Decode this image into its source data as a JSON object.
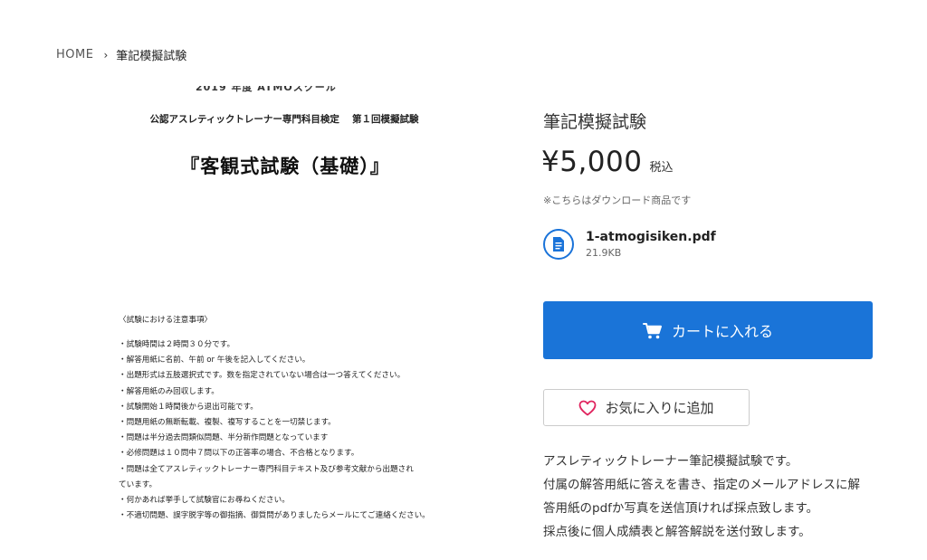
{
  "breadcrumb": {
    "home": "HOME",
    "separator": "›",
    "current": "筆記模擬試験"
  },
  "preview": {
    "cut_text": "2019 年度 ATMOスクール",
    "heading": "公認アスレティックトレーナー専門科目検定　 第１回模擬試験",
    "title": "『客観式試験（基礎）』",
    "notes_title": "〈試験における注意事項〉",
    "notes": [
      "・試験時間は２時間３０分です。",
      "・解答用紙に名前、午前 or 午後を記入してください。",
      "・出題形式は五肢選択式です。数を指定されていない場合は一つ答えてください。",
      "・解答用紙のみ回収します。",
      "・試験開始１時間後から退出可能です。",
      "・問題用紙の無断転載、複製、複写することを一切禁じます。",
      "・問題は半分過去問類似問題、半分新作問題となっています",
      "・必修問題は１０問中７問以下の正答率の場合、不合格となります。",
      "・問題は全てアスレティックトレーナー専門科目テキスト及び参考文献から出題され",
      "ています。",
      "・何かあれば挙手して試験官にお尋ねください。",
      "・不適切問題、誤字脱字等の御指摘、御質問がありましたらメールにてご連絡ください。"
    ]
  },
  "product": {
    "title": "筆記模擬試験",
    "price": "¥5,000",
    "tax_label": "税込",
    "download_note": "※こちらはダウンロード商品です",
    "file": {
      "icon": "document-icon",
      "name": "1-atmogisiken.pdf",
      "size": "21.9KB"
    },
    "cart_label": "カートに入れる",
    "favorite_label": "お気に入りに追加",
    "description": [
      "アスレティックトレーナー筆記模擬試験です。",
      "付属の解答用紙に答えを書き、指定のメールアドレスに解",
      "答用紙のpdfか写真を送信頂ければ採点致します。",
      "採点後に個人成績表と解答解説を送付致します。"
    ]
  },
  "colors": {
    "accent": "#1a74d8",
    "heart": "#e0245e"
  }
}
